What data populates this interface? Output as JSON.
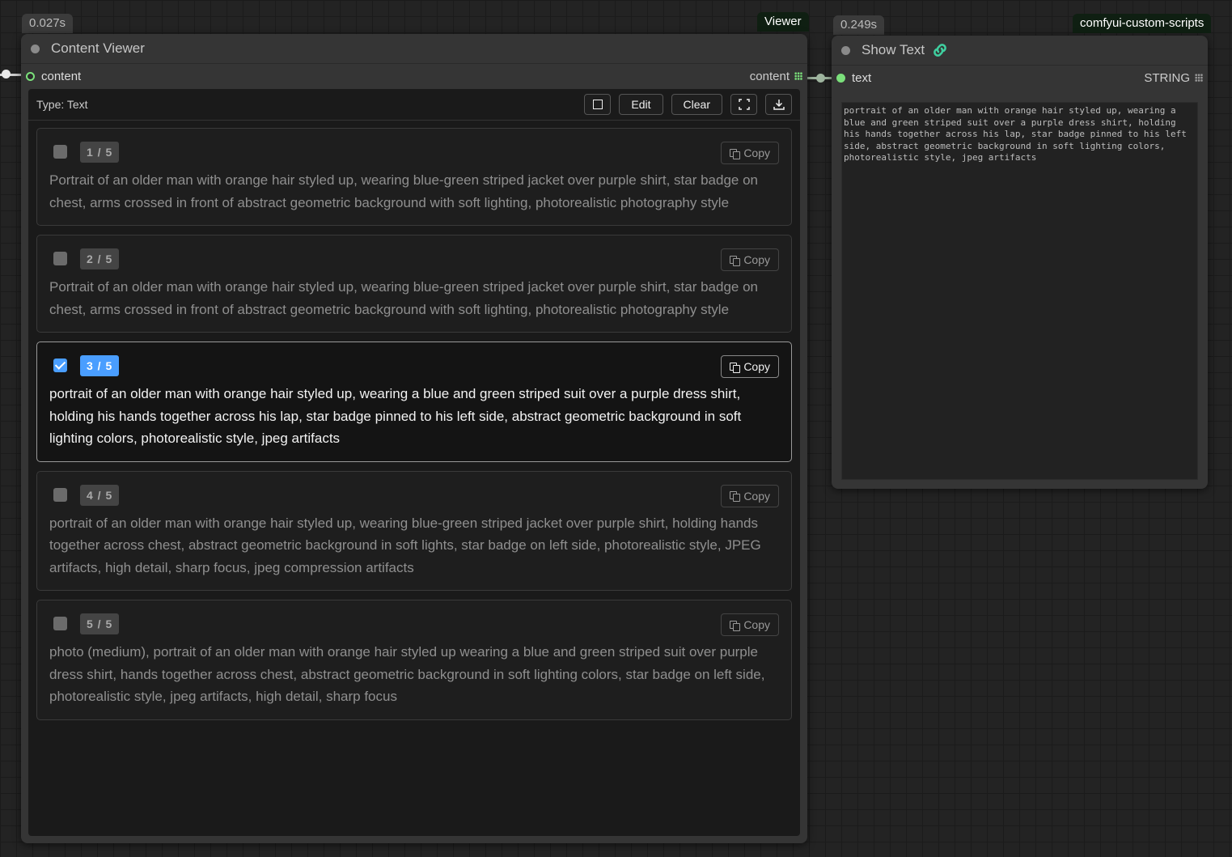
{
  "viewer_node": {
    "time_badge": "0.027s",
    "source_badge": "Viewer",
    "title": "Content Viewer",
    "input_label": "content",
    "output_label": "content",
    "toolbar": {
      "type_label": "Type: Text",
      "edit_label": "Edit",
      "clear_label": "Clear"
    },
    "entries": [
      {
        "index": "1 / 5",
        "checked": false,
        "copy_label": "Copy",
        "text": "Portrait of an older man with orange hair styled up, wearing blue-green striped jacket over purple shirt, star badge on chest, arms crossed in front of abstract geometric background with soft lighting, photorealistic photography style"
      },
      {
        "index": "2 / 5",
        "checked": false,
        "copy_label": "Copy",
        "text": "Portrait of an older man with orange hair styled up, wearing blue-green striped jacket over purple shirt, star badge on chest, arms crossed in front of abstract geometric background with soft lighting, photorealistic photography style"
      },
      {
        "index": "3 / 5",
        "checked": true,
        "copy_label": "Copy",
        "text": "portrait of an older man with orange hair styled up, wearing a blue and green striped suit over a purple dress shirt, holding his hands together across his lap, star badge pinned to his left side, abstract geometric background in soft lighting colors, photorealistic style, jpeg artifacts"
      },
      {
        "index": "4 / 5",
        "checked": false,
        "copy_label": "Copy",
        "text": "portrait of an older man with orange hair styled up, wearing blue-green striped jacket over purple shirt, holding hands together across chest, abstract geometric background in soft lights, star badge on left side, photorealistic style, JPEG artifacts, high detail, sharp focus, jpeg compression artifacts"
      },
      {
        "index": "5 / 5",
        "checked": false,
        "copy_label": "Copy",
        "text": "photo (medium), portrait of an older man with orange hair styled up wearing a blue and green striped suit over purple dress shirt, hands together across chest, abstract geometric background in soft lighting colors, star badge on left side, photorealistic style, jpeg artifacts, high detail, sharp focus"
      }
    ]
  },
  "show_text_node": {
    "time_badge": "0.249s",
    "source_badge": "comfyui-custom-scripts",
    "title": "Show Text",
    "input_label": "text",
    "output_label": "STRING",
    "text": "portrait of an older man with orange hair styled up, wearing a blue and green striped suit over a purple dress shirt, holding his hands together across his lap, star badge pinned to his left side, abstract geometric background in soft lighting colors, photorealistic style, jpeg artifacts"
  },
  "colors": {
    "accent": "#4a9eff",
    "slot_green": "#7be07b",
    "link_icon": "#3fcf9f"
  }
}
